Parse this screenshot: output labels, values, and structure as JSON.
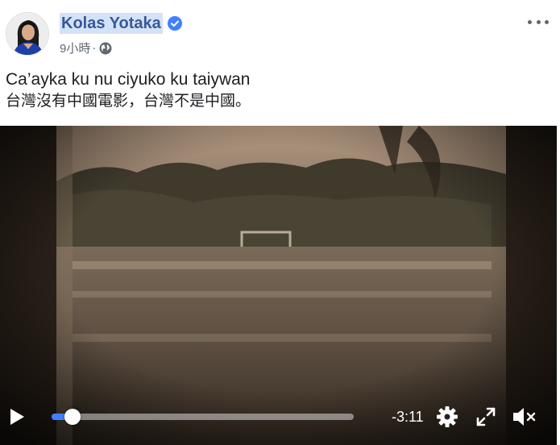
{
  "post": {
    "author_name": "Kolas Yotaka",
    "timestamp": "9小時",
    "separator": "·",
    "privacy_icon": "globe-icon",
    "verified_icon": "verified-badge-icon",
    "more_icon": "more-options-icon",
    "text_line_1": "Ca’ayka ku nu ciyuko ku taiywan",
    "text_line_2": "台灣沒有中國電影，台灣不是中國。"
  },
  "video": {
    "play_icon": "play-icon",
    "progress": 0.04,
    "time_remaining": "-3:11",
    "settings_icon": "gear-icon",
    "fullscreen_icon": "expand-icon",
    "volume_icon": "muted-speaker-icon"
  },
  "colors": {
    "author_link": "#385898",
    "author_highlight": "#d4e2f7",
    "verified_badge": "#4080ff",
    "progress_fill": "#4080ff"
  }
}
